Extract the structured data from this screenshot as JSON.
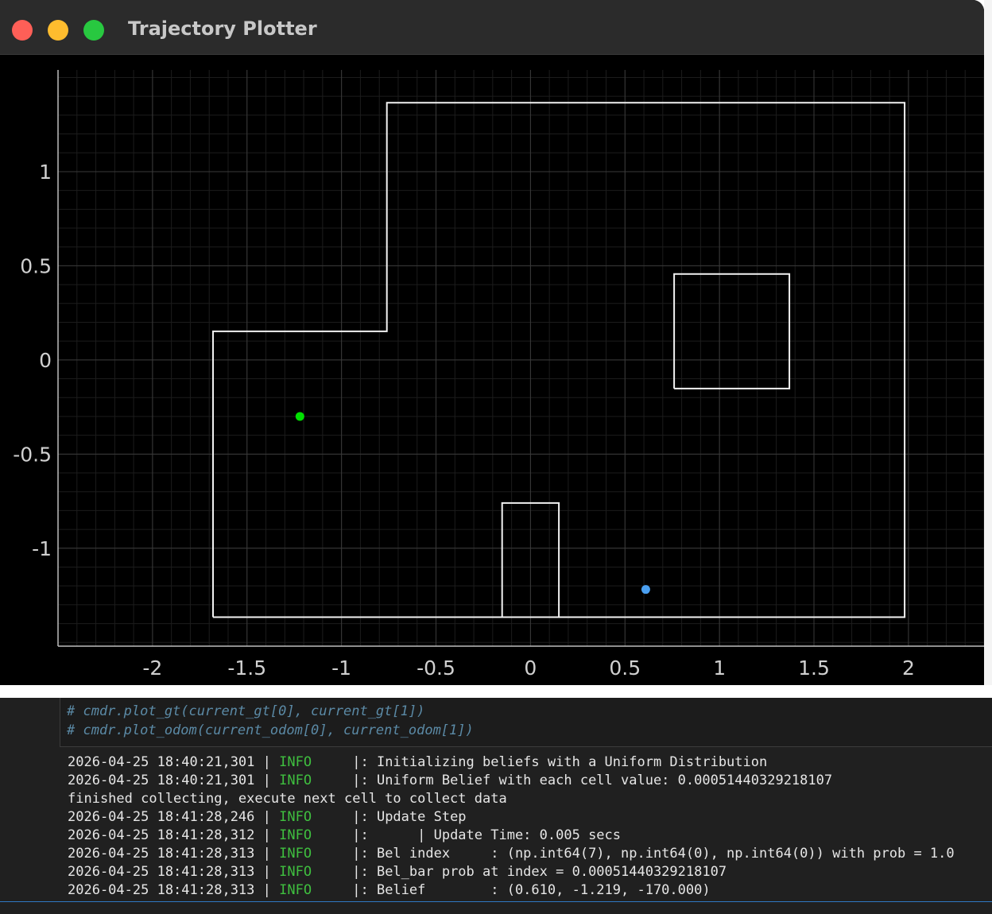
{
  "window": {
    "title": "Trajectory Plotter"
  },
  "chart_data": {
    "type": "scatter",
    "xlim": [
      -2.5,
      2.4
    ],
    "ylim": [
      -1.52,
      1.54
    ],
    "x_ticks": [
      "-2",
      "-1.5",
      "-1",
      "-0.5",
      "0",
      "0.5",
      "1",
      "1.5",
      "2"
    ],
    "x_tick_values": [
      -2,
      -1.5,
      -1,
      -0.5,
      0,
      0.5,
      1,
      1.5,
      2
    ],
    "y_ticks": [
      "1",
      "0.5",
      "0",
      "-0.5",
      "-1"
    ],
    "y_tick_values": [
      1,
      0.5,
      0,
      -0.5,
      -1
    ],
    "grid": true,
    "walls": [
      {
        "points": [
          [
            -1.68,
            -1.366
          ],
          [
            1.98,
            -1.366
          ],
          [
            1.98,
            1.366
          ],
          [
            -0.76,
            1.366
          ],
          [
            -0.76,
            0.152
          ],
          [
            -1.68,
            0.152
          ],
          [
            -1.68,
            -1.366
          ]
        ]
      },
      {
        "points": [
          [
            0.76,
            -0.152
          ],
          [
            1.37,
            -0.152
          ],
          [
            1.37,
            0.456
          ],
          [
            0.76,
            0.456
          ],
          [
            0.76,
            -0.152
          ]
        ]
      },
      {
        "points": [
          [
            -0.15,
            -1.366
          ],
          [
            -0.15,
            -0.76
          ],
          [
            0.15,
            -0.76
          ],
          [
            0.15,
            -1.366
          ]
        ]
      }
    ],
    "series": [
      {
        "color": "#00e000",
        "points": [
          [
            -1.22,
            -0.3
          ]
        ]
      },
      {
        "color": "#4a9ff0",
        "points": [
          [
            0.61,
            -1.219
          ]
        ]
      }
    ]
  },
  "notebook": {
    "code_lines": [
      "# cmdr.plot_gt(current_gt[0], current_gt[1])",
      "# cmdr.plot_odom(current_odom[0], current_odom[1])"
    ],
    "log": [
      {
        "ts": "2026-04-25 18:40:21,301",
        "sep": " | ",
        "level": "INFO",
        "msg": "     |: Initializing beliefs with a Uniform Distribution"
      },
      {
        "ts": "2026-04-25 18:40:21,301",
        "sep": " | ",
        "level": "INFO",
        "msg": "     |: Uniform Belief with each cell value: 0.00051440329218107"
      },
      {
        "ts": "finished collecting, execute next cell to collect data",
        "sep": "",
        "level": "",
        "msg": ""
      },
      {
        "ts": "2026-04-25 18:41:28,246",
        "sep": " | ",
        "level": "INFO",
        "msg": "     |: Update Step"
      },
      {
        "ts": "2026-04-25 18:41:28,312",
        "sep": " | ",
        "level": "INFO",
        "msg": "     |:      | Update Time: 0.005 secs"
      },
      {
        "ts": "2026-04-25 18:41:28,313",
        "sep": " | ",
        "level": "INFO",
        "msg": "     |: Bel index     : (np.int64(7), np.int64(0), np.int64(0)) with prob = 1.0"
      },
      {
        "ts": "2026-04-25 18:41:28,313",
        "sep": " | ",
        "level": "INFO",
        "msg": "     |: Bel_bar prob at index = 0.00051440329218107"
      },
      {
        "ts": "2026-04-25 18:41:28,313",
        "sep": " | ",
        "level": "INFO",
        "msg": "     |: Belief        : (0.610, -1.219, -170.000)"
      }
    ]
  }
}
